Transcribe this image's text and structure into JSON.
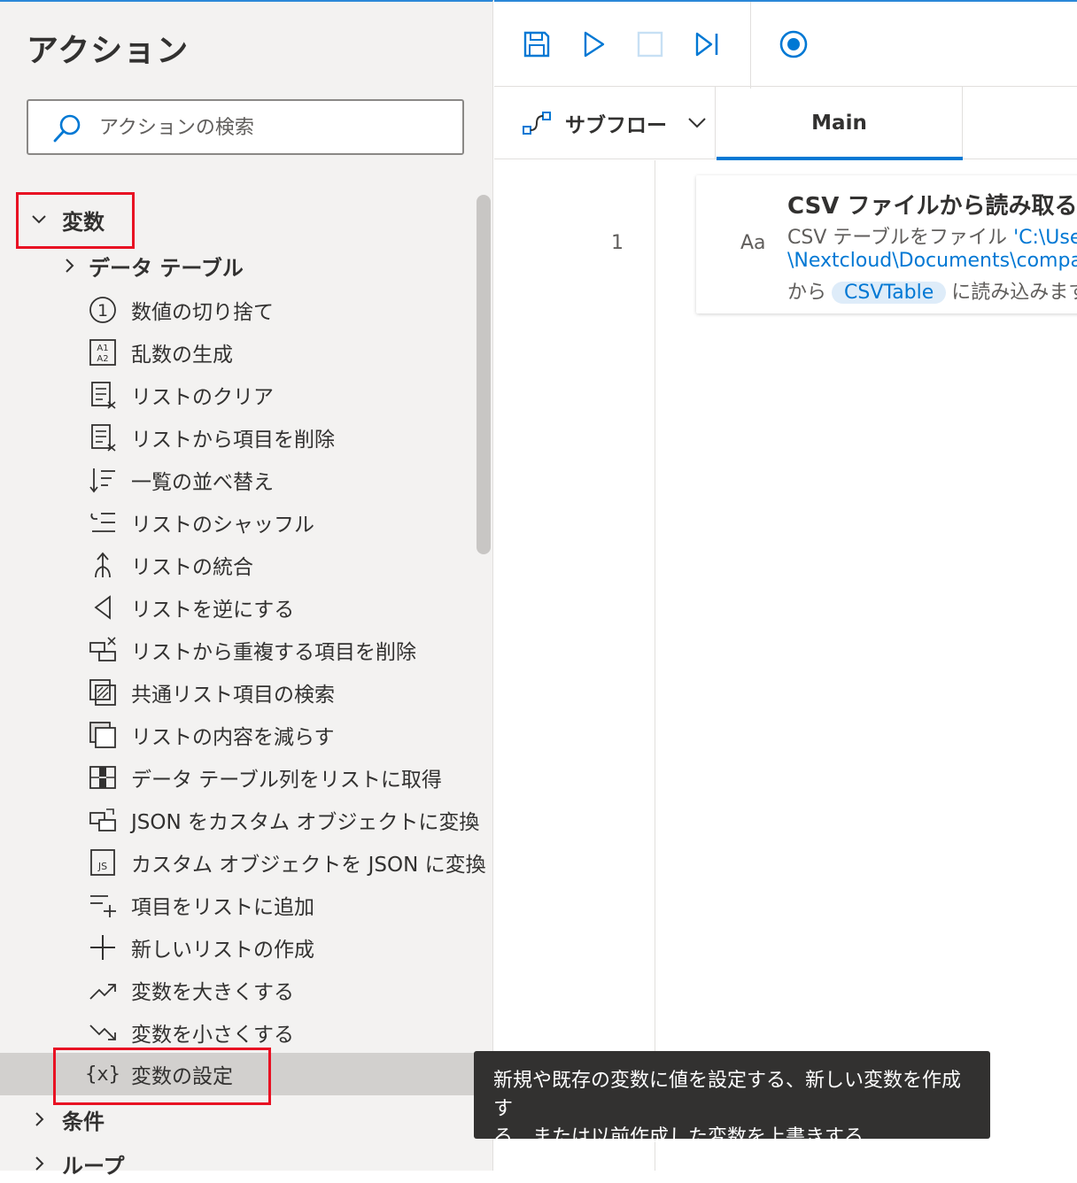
{
  "panel": {
    "title": "アクション",
    "search_placeholder": "アクションの検索"
  },
  "tree": {
    "category_variables": "変数",
    "subgroup_datatable": "データ テーブル",
    "items": [
      {
        "label": "数値の切り捨て",
        "icon": "circle-one-icon"
      },
      {
        "label": "乱数の生成",
        "icon": "random-number-icon"
      },
      {
        "label": "リストのクリア",
        "icon": "list-clear-icon"
      },
      {
        "label": "リストから項目を削除",
        "icon": "list-remove-item-icon"
      },
      {
        "label": "一覧の並べ替え",
        "icon": "sort-list-icon"
      },
      {
        "label": "リストのシャッフル",
        "icon": "shuffle-list-icon"
      },
      {
        "label": "リストの統合",
        "icon": "merge-list-icon"
      },
      {
        "label": "リストを逆にする",
        "icon": "reverse-list-icon"
      },
      {
        "label": "リストから重複する項目を削除",
        "icon": "remove-duplicates-icon"
      },
      {
        "label": "共通リスト項目の検索",
        "icon": "common-items-icon"
      },
      {
        "label": "リストの内容を減らす",
        "icon": "subtract-list-icon"
      },
      {
        "label": "データ テーブル列をリストに取得",
        "icon": "datatable-column-icon"
      },
      {
        "label": "JSON をカスタム オブジェクトに変換",
        "icon": "json-to-object-icon"
      },
      {
        "label": "カスタム オブジェクトを JSON に変換",
        "icon": "object-to-json-icon"
      },
      {
        "label": "項目をリストに追加",
        "icon": "add-item-icon"
      },
      {
        "label": "新しいリストの作成",
        "icon": "plus-icon"
      },
      {
        "label": "変数を大きくする",
        "icon": "trend-up-icon"
      },
      {
        "label": "変数を小さくする",
        "icon": "trend-down-icon"
      },
      {
        "label": "変数の設定",
        "icon": "variable-braces-icon",
        "icon_text": "{x}"
      }
    ],
    "category_conditions": "条件",
    "category_loops": "ループ"
  },
  "toolbar": {
    "save_icon": "save-icon",
    "run_icon": "play-icon",
    "stop_icon": "stop-icon",
    "step_icon": "step-icon",
    "record_icon": "record-icon"
  },
  "tabs": {
    "subflow_label": "サブフロー",
    "main_label": "Main"
  },
  "flow": {
    "line_number": "1",
    "card": {
      "icon_text": "Aa",
      "title": "CSV ファイルから読み取る",
      "line1_text": "CSV テーブルをファイル",
      "line1_link": "'C:\\Users\\ri",
      "line2_link": "\\Nextcloud\\Documents\\compa",
      "line3_prefix": "から",
      "line3_variable": "CSVTable",
      "line3_suffix": "に読み込みます"
    }
  },
  "tooltip": {
    "line1": "新規や既存の変数に値を設定する、新しい変数を作成す",
    "line2": "る、または以前作成した変数を上書きする"
  },
  "colors": {
    "accent": "#0078d4",
    "highlight_box": "#e81123",
    "selected_row": "#d2d0ce",
    "panel_bg": "#f3f2f1"
  }
}
